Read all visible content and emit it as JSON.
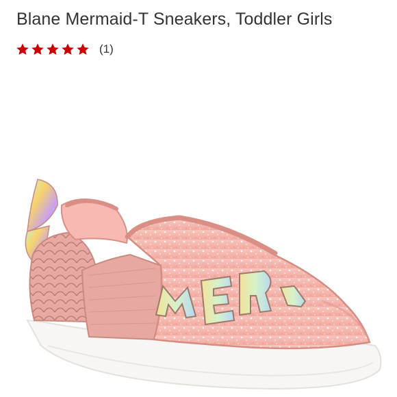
{
  "product": {
    "title": "Blane Mermaid-T Sneakers, Toddler Girls",
    "rating": {
      "stars": 5,
      "max": 5,
      "review_count": "(1)",
      "star_color": "#cc0000"
    },
    "image": {
      "icon": "sneaker-image",
      "shoe_color": "#f4b5ae",
      "sole_color": "#f7f5f3"
    }
  }
}
